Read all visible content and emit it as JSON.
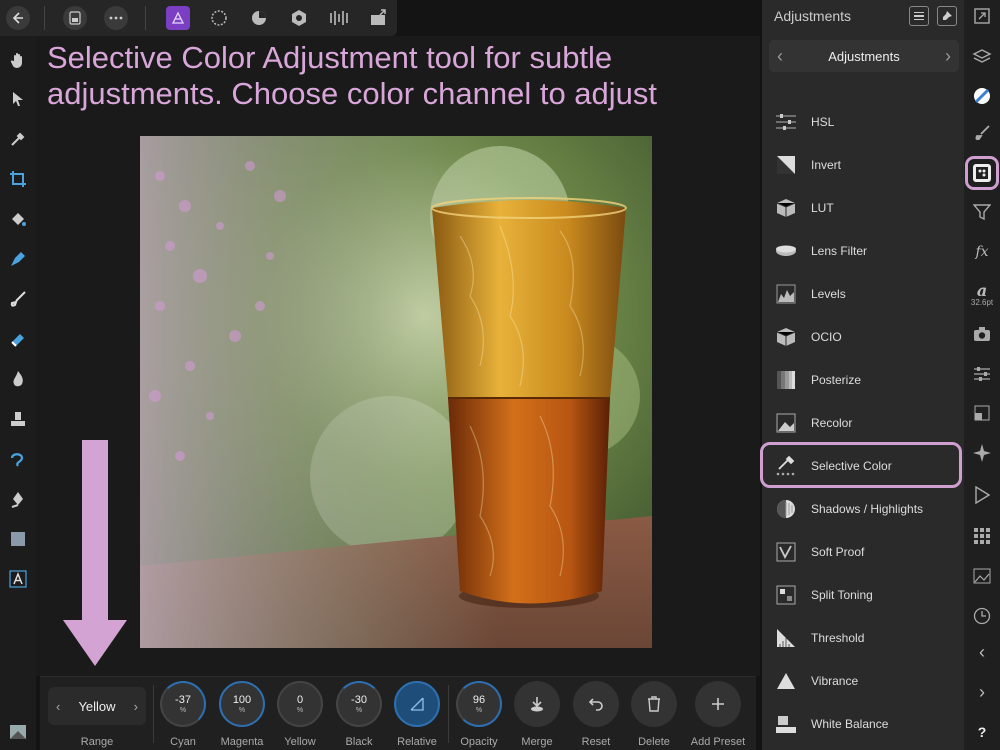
{
  "annotation": {
    "text": "Selective Color Adjustment tool for subtle adjustments. Choose color channel to adjust"
  },
  "colors": {
    "accent": "#cf9fd0",
    "arrow": "#d3a4d3",
    "dial_ring": "#2d6fb0",
    "panel_bg": "#2a2a2a"
  },
  "panel": {
    "title": "Adjustments",
    "nav_title": "Adjustments",
    "items": [
      {
        "label": "HSL",
        "icon": "hsl-sliders-icon"
      },
      {
        "label": "Invert",
        "icon": "invert-icon"
      },
      {
        "label": "LUT",
        "icon": "lut-cube-icon"
      },
      {
        "label": "Lens Filter",
        "icon": "lens-filter-icon"
      },
      {
        "label": "Levels",
        "icon": "levels-icon"
      },
      {
        "label": "OCIO",
        "icon": "ocio-cube-icon"
      },
      {
        "label": "Posterize",
        "icon": "posterize-icon"
      },
      {
        "label": "Recolor",
        "icon": "recolor-icon"
      },
      {
        "label": "Selective Color",
        "icon": "selective-color-icon"
      },
      {
        "label": "Shadows / Highlights",
        "icon": "shadows-highlights-icon"
      },
      {
        "label": "Soft Proof",
        "icon": "soft-proof-icon"
      },
      {
        "label": "Split Toning",
        "icon": "split-toning-icon"
      },
      {
        "label": "Threshold",
        "icon": "threshold-icon"
      },
      {
        "label": "Vibrance",
        "icon": "vibrance-icon"
      },
      {
        "label": "White Balance",
        "icon": "white-balance-icon"
      }
    ]
  },
  "studio": {
    "font_size": "32.6pt"
  },
  "context": {
    "range_value": "Yellow",
    "range_label": "Range",
    "cyan": {
      "value": "-37",
      "unit": "%",
      "label": "Cyan"
    },
    "magenta": {
      "value": "100",
      "unit": "%",
      "label": "Magenta"
    },
    "yellow": {
      "value": "0",
      "unit": "%",
      "label": "Yellow"
    },
    "black": {
      "value": "-30",
      "unit": "%",
      "label": "Black"
    },
    "relative_label": "Relative",
    "opacity": {
      "value": "96",
      "unit": "%",
      "label": "Opacity"
    },
    "merge_label": "Merge",
    "reset_label": "Reset",
    "delete_label": "Delete",
    "add_preset_label": "Add Preset"
  }
}
